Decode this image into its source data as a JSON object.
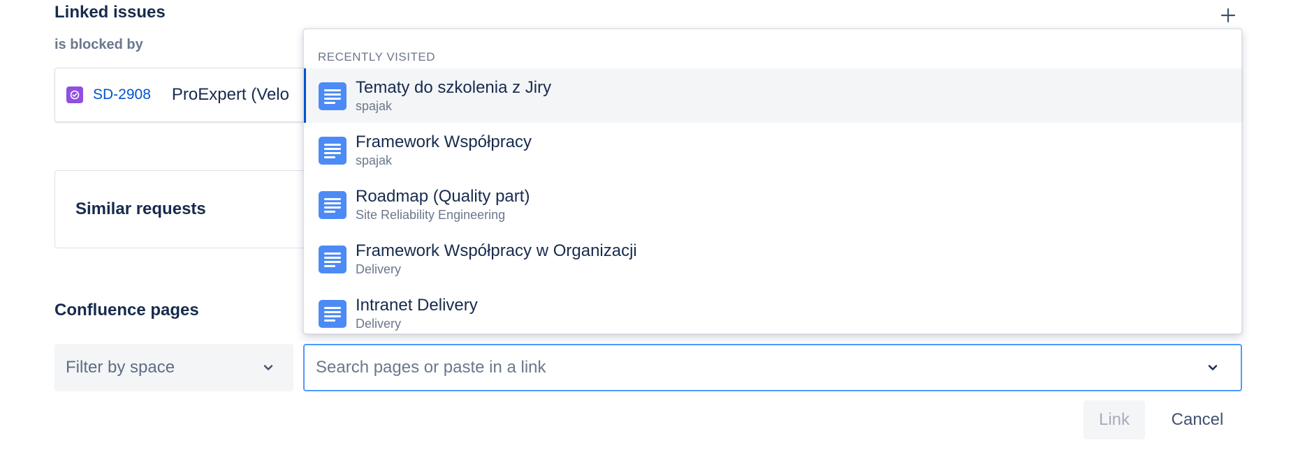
{
  "linked_issues": {
    "title": "Linked issues",
    "relation": "is blocked by",
    "issue": {
      "key": "SD-2908",
      "summary": "ProExpert (Velo"
    },
    "add_icon": "plus-icon"
  },
  "similar_requests": {
    "title": "Similar requests"
  },
  "confluence": {
    "title": "Confluence pages",
    "space_filter": {
      "placeholder": "Filter by space"
    },
    "search": {
      "placeholder": "Search pages or paste in a link",
      "value": ""
    },
    "link_label": "Link",
    "cancel_label": "Cancel"
  },
  "dropdown": {
    "heading": "RECENTLY VISITED",
    "items": [
      {
        "title": "Tematy do szkolenia z Jiry",
        "space": "spajak",
        "selected": true
      },
      {
        "title": "Framework Współpracy",
        "space": "spajak",
        "selected": false
      },
      {
        "title": "Roadmap (Quality part)",
        "space": "Site Reliability Engineering",
        "selected": false
      },
      {
        "title": "Framework Współpracy w Organizacji",
        "space": "Delivery",
        "selected": false
      },
      {
        "title": "Intranet Delivery",
        "space": "Delivery",
        "selected": false
      }
    ]
  },
  "colors": {
    "text_primary": "#172b4d",
    "text_subtle": "#6b778c",
    "link_blue": "#0052cc",
    "focus_border": "#4c9aff",
    "page_icon": "#4c8bf5",
    "issue_type": "#904ee2"
  }
}
